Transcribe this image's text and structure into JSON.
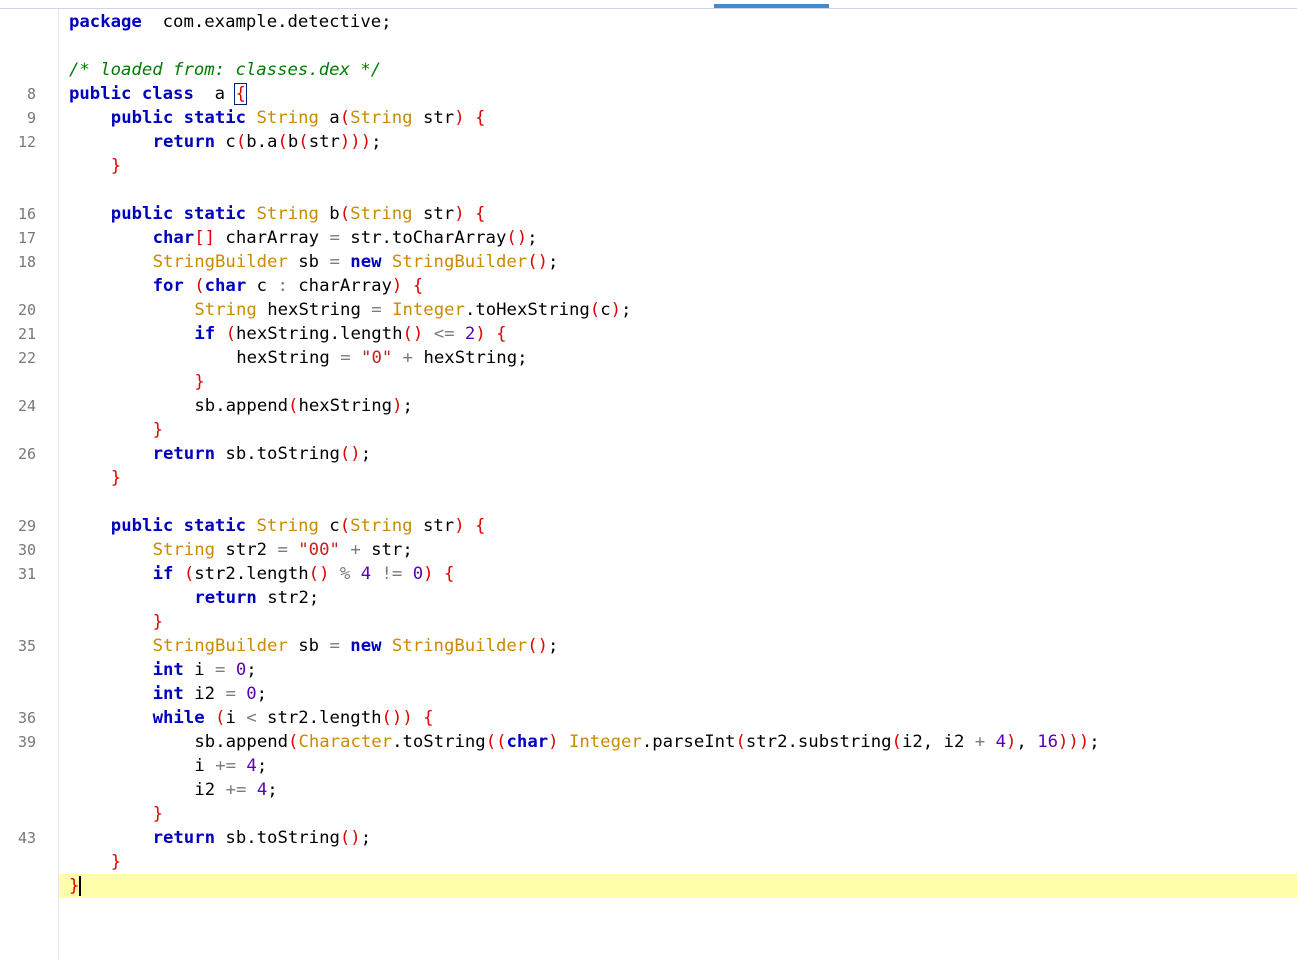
{
  "editor": {
    "gutter_line_numbers": [
      {
        "row": 3,
        "num": "8"
      },
      {
        "row": 4,
        "num": "9"
      },
      {
        "row": 5,
        "num": "12"
      },
      {
        "row": 8,
        "num": "16"
      },
      {
        "row": 9,
        "num": "17"
      },
      {
        "row": 10,
        "num": "18"
      },
      {
        "row": 12,
        "num": "20"
      },
      {
        "row": 13,
        "num": "21"
      },
      {
        "row": 14,
        "num": "22"
      },
      {
        "row": 16,
        "num": "24"
      },
      {
        "row": 18,
        "num": "26"
      },
      {
        "row": 21,
        "num": "29"
      },
      {
        "row": 22,
        "num": "30"
      },
      {
        "row": 23,
        "num": "31"
      },
      {
        "row": 26,
        "num": "35"
      },
      {
        "row": 29,
        "num": "36"
      },
      {
        "row": 30,
        "num": "39"
      },
      {
        "row": 34,
        "num": "43"
      }
    ],
    "lines": [
      [
        [
          "kw",
          "package"
        ],
        [
          "",
          "  com.example.detective;"
        ]
      ],
      [],
      [
        [
          "cm",
          "/* loaded from: classes.dex */"
        ]
      ],
      [
        [
          "kw",
          "public class"
        ],
        [
          "",
          "  a "
        ],
        [
          "pu-box",
          "{"
        ]
      ],
      [
        [
          "",
          ""
        ],
        [
          "kw",
          "public static"
        ],
        [
          "",
          " "
        ],
        [
          "ty",
          "String"
        ],
        [
          "",
          " a"
        ],
        [
          "pu",
          "("
        ],
        [
          "ty",
          "String"
        ],
        [
          "",
          " str"
        ],
        [
          "pu",
          ")"
        ],
        [
          "",
          " "
        ],
        [
          "pu",
          "{"
        ]
      ],
      [
        [
          "",
          ""
        ],
        [
          "kw",
          "return"
        ],
        [
          "",
          " c"
        ],
        [
          "pu",
          "("
        ],
        [
          "",
          "b.a"
        ],
        [
          "pu",
          "("
        ],
        [
          "",
          "b"
        ],
        [
          "pu",
          "("
        ],
        [
          "",
          "str"
        ],
        [
          "pu",
          ")))"
        ],
        [
          "",
          ";"
        ]
      ],
      [
        [
          "pu",
          "}"
        ]
      ],
      [],
      [
        [
          "kw",
          "public static"
        ],
        [
          "",
          " "
        ],
        [
          "ty",
          "String"
        ],
        [
          "",
          " b"
        ],
        [
          "pu",
          "("
        ],
        [
          "ty",
          "String"
        ],
        [
          "",
          " str"
        ],
        [
          "pu",
          ")"
        ],
        [
          "",
          " "
        ],
        [
          "pu",
          "{"
        ]
      ],
      [
        [
          "kw",
          "char"
        ],
        [
          "pu",
          "[]"
        ],
        [
          "",
          " charArray "
        ],
        [
          "op",
          "="
        ],
        [
          "",
          " str.toCharArray"
        ],
        [
          "pu",
          "()"
        ],
        [
          "",
          ";"
        ]
      ],
      [
        [
          "ty",
          "StringBuilder"
        ],
        [
          "",
          " sb "
        ],
        [
          "op",
          "="
        ],
        [
          "",
          " "
        ],
        [
          "kw",
          "new"
        ],
        [
          "",
          " "
        ],
        [
          "ty",
          "StringBuilder"
        ],
        [
          "pu",
          "()"
        ],
        [
          "",
          ";"
        ]
      ],
      [
        [
          "kw",
          "for"
        ],
        [
          "",
          " "
        ],
        [
          "pu",
          "("
        ],
        [
          "kw",
          "char"
        ],
        [
          "",
          " c "
        ],
        [
          "op",
          ":"
        ],
        [
          "",
          " charArray"
        ],
        [
          "pu",
          ")"
        ],
        [
          "",
          " "
        ],
        [
          "pu",
          "{"
        ]
      ],
      [
        [
          "ty",
          "String"
        ],
        [
          "",
          " hexString "
        ],
        [
          "op",
          "="
        ],
        [
          "",
          " "
        ],
        [
          "ty",
          "Integer"
        ],
        [
          "",
          ".toHexString"
        ],
        [
          "pu",
          "("
        ],
        [
          "",
          "c"
        ],
        [
          "pu",
          ")"
        ],
        [
          "",
          ";"
        ]
      ],
      [
        [
          "kw",
          "if"
        ],
        [
          "",
          " "
        ],
        [
          "pu",
          "("
        ],
        [
          "",
          "hexString.length"
        ],
        [
          "pu",
          "()"
        ],
        [
          "",
          " "
        ],
        [
          "op",
          "<="
        ],
        [
          "",
          " "
        ],
        [
          "nu",
          "2"
        ],
        [
          "pu",
          ")"
        ],
        [
          "",
          " "
        ],
        [
          "pu",
          "{"
        ]
      ],
      [
        [
          "",
          "hexString "
        ],
        [
          "op",
          "="
        ],
        [
          "",
          " "
        ],
        [
          "st",
          "\"0\""
        ],
        [
          "",
          " "
        ],
        [
          "op",
          "+"
        ],
        [
          "",
          " hexString;"
        ]
      ],
      [
        [
          "pu",
          "}"
        ]
      ],
      [
        [
          "",
          "sb.append"
        ],
        [
          "pu",
          "("
        ],
        [
          "",
          "hexString"
        ],
        [
          "pu",
          ")"
        ],
        [
          "",
          ";"
        ]
      ],
      [
        [
          "pu",
          "}"
        ]
      ],
      [
        [
          "kw",
          "return"
        ],
        [
          "",
          " sb.toString"
        ],
        [
          "pu",
          "()"
        ],
        [
          "",
          ";"
        ]
      ],
      [
        [
          "pu",
          "}"
        ]
      ],
      [],
      [
        [
          "kw",
          "public static"
        ],
        [
          "",
          " "
        ],
        [
          "ty",
          "String"
        ],
        [
          "",
          " c"
        ],
        [
          "pu",
          "("
        ],
        [
          "ty",
          "String"
        ],
        [
          "",
          " str"
        ],
        [
          "pu",
          ")"
        ],
        [
          "",
          " "
        ],
        [
          "pu",
          "{"
        ]
      ],
      [
        [
          "ty",
          "String"
        ],
        [
          "",
          " str2 "
        ],
        [
          "op",
          "="
        ],
        [
          "",
          " "
        ],
        [
          "st",
          "\"00\""
        ],
        [
          "",
          " "
        ],
        [
          "op",
          "+"
        ],
        [
          "",
          " str;"
        ]
      ],
      [
        [
          "kw",
          "if"
        ],
        [
          "",
          " "
        ],
        [
          "pu",
          "("
        ],
        [
          "",
          "str2.length"
        ],
        [
          "pu",
          "()"
        ],
        [
          "",
          " "
        ],
        [
          "op",
          "%"
        ],
        [
          "",
          " "
        ],
        [
          "nu",
          "4"
        ],
        [
          "",
          " "
        ],
        [
          "op",
          "!="
        ],
        [
          "",
          " "
        ],
        [
          "nu",
          "0"
        ],
        [
          "pu",
          ")"
        ],
        [
          "",
          " "
        ],
        [
          "pu",
          "{"
        ]
      ],
      [
        [
          "kw",
          "return"
        ],
        [
          "",
          " str2;"
        ]
      ],
      [
        [
          "pu",
          "}"
        ]
      ],
      [
        [
          "ty",
          "StringBuilder"
        ],
        [
          "",
          " sb "
        ],
        [
          "op",
          "="
        ],
        [
          "",
          " "
        ],
        [
          "kw",
          "new"
        ],
        [
          "",
          " "
        ],
        [
          "ty",
          "StringBuilder"
        ],
        [
          "pu",
          "()"
        ],
        [
          "",
          ";"
        ]
      ],
      [
        [
          "kw",
          "int"
        ],
        [
          "",
          " i "
        ],
        [
          "op",
          "="
        ],
        [
          "",
          " "
        ],
        [
          "nu",
          "0"
        ],
        [
          "",
          ";"
        ]
      ],
      [
        [
          "kw",
          "int"
        ],
        [
          "",
          " i2 "
        ],
        [
          "op",
          "="
        ],
        [
          "",
          " "
        ],
        [
          "nu",
          "0"
        ],
        [
          "",
          ";"
        ]
      ],
      [
        [
          "kw",
          "while"
        ],
        [
          "",
          " "
        ],
        [
          "pu",
          "("
        ],
        [
          "",
          "i "
        ],
        [
          "op",
          "<"
        ],
        [
          "",
          " str2.length"
        ],
        [
          "pu",
          "()"
        ],
        [
          "pu",
          ")"
        ],
        [
          "",
          " "
        ],
        [
          "pu",
          "{"
        ]
      ],
      [
        [
          "",
          "sb.append"
        ],
        [
          "pu",
          "("
        ],
        [
          "ty",
          "Character"
        ],
        [
          "",
          ".toString"
        ],
        [
          "pu",
          "(("
        ],
        [
          "kw",
          "char"
        ],
        [
          "pu",
          ")"
        ],
        [
          "",
          " "
        ],
        [
          "ty",
          "Integer"
        ],
        [
          "",
          ".parseInt"
        ],
        [
          "pu",
          "("
        ],
        [
          "",
          "str2.substring"
        ],
        [
          "pu",
          "("
        ],
        [
          "",
          "i2, i2 "
        ],
        [
          "op",
          "+"
        ],
        [
          "",
          " "
        ],
        [
          "nu",
          "4"
        ],
        [
          "pu",
          ")"
        ],
        [
          "",
          ", "
        ],
        [
          "nu",
          "16"
        ],
        [
          "pu",
          ")))"
        ],
        [
          "",
          ";"
        ]
      ],
      [
        [
          "",
          "i "
        ],
        [
          "op",
          "+="
        ],
        [
          "",
          " "
        ],
        [
          "nu",
          "4"
        ],
        [
          "",
          ";"
        ]
      ],
      [
        [
          "",
          "i2 "
        ],
        [
          "op",
          "+="
        ],
        [
          "",
          " "
        ],
        [
          "nu",
          "4"
        ],
        [
          "",
          ";"
        ]
      ],
      [
        [
          "pu",
          "}"
        ]
      ],
      [
        [
          "kw",
          "return"
        ],
        [
          "",
          " sb.toString"
        ],
        [
          "pu",
          "()"
        ],
        [
          "",
          ";"
        ]
      ],
      [
        [
          "pu",
          "}"
        ]
      ],
      [
        [
          "pu",
          "}"
        ],
        [
          "caret",
          ""
        ]
      ]
    ],
    "indents": [
      0,
      0,
      0,
      0,
      1,
      2,
      1,
      0,
      1,
      2,
      2,
      2,
      3,
      3,
      4,
      3,
      3,
      2,
      2,
      1,
      0,
      1,
      2,
      2,
      3,
      2,
      2,
      2,
      2,
      2,
      3,
      3,
      3,
      2,
      2,
      1,
      0
    ],
    "current_line_row": 36
  }
}
